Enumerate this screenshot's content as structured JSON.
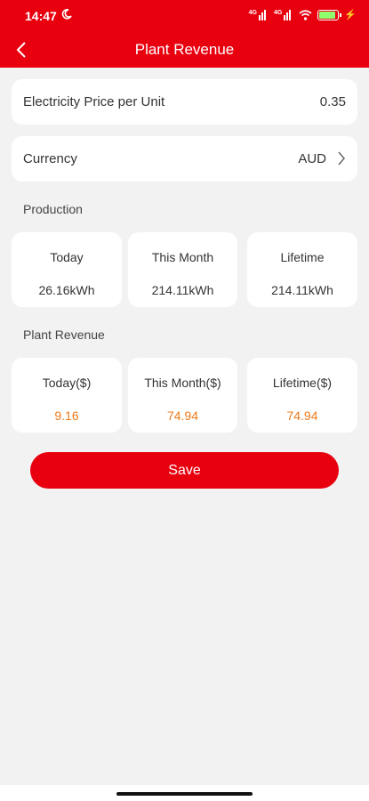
{
  "status_bar": {
    "time": "14:47",
    "network_label_1": "4G",
    "network_label_2": "4G"
  },
  "header": {
    "title": "Plant Revenue"
  },
  "settings": {
    "price_label": "Electricity Price per Unit",
    "price_value": "0.35",
    "currency_label": "Currency",
    "currency_value": "AUD"
  },
  "production": {
    "title": "Production",
    "items": [
      {
        "label": "Today",
        "value": "26.16kWh"
      },
      {
        "label": "This Month",
        "value": "214.11kWh"
      },
      {
        "label": "Lifetime",
        "value": "214.11kWh"
      }
    ]
  },
  "revenue": {
    "title": "Plant Revenue",
    "items": [
      {
        "label": "Today($)",
        "value": "9.16"
      },
      {
        "label": "This Month($)",
        "value": "74.94"
      },
      {
        "label": "Lifetime($)",
        "value": "74.94"
      }
    ]
  },
  "actions": {
    "save_label": "Save"
  },
  "colors": {
    "brand_red": "#e8000f",
    "revenue_orange": "#ee7a1a",
    "background": "#f2f2f2"
  }
}
